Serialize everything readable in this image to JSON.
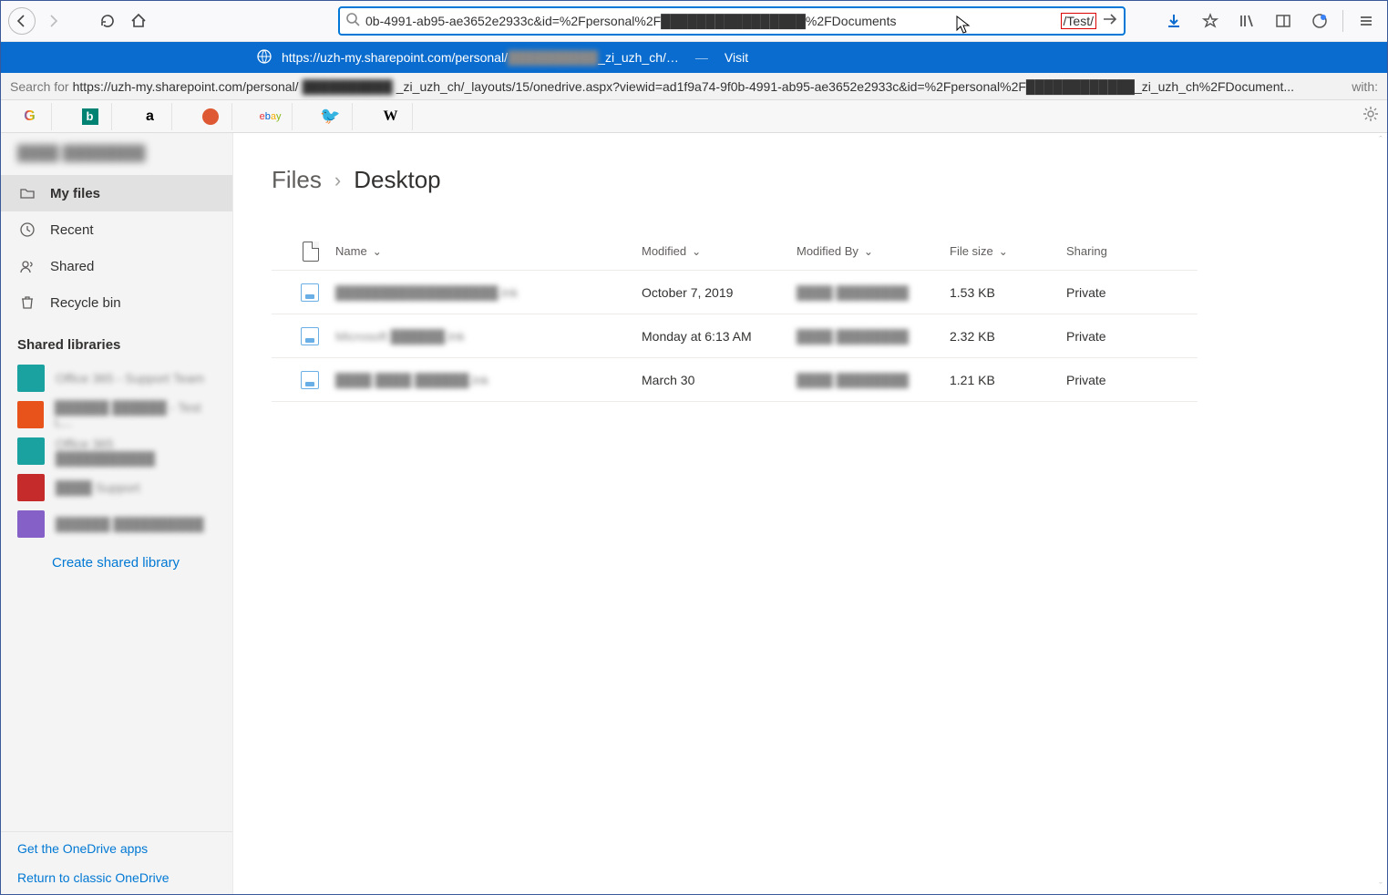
{
  "browser": {
    "url_text": "0b-4991-ab95-ae3652e2933c&id=%2Fpersonal%2F████████████████%2FDocuments",
    "url_highlight": "/Test/",
    "visit_url_pre": "https://uzh-my.sharepoint.com/personal/",
    "visit_url_mid": "██████████",
    "visit_url_post": "_zi_uzh_ch/",
    "visit_label": "Visit",
    "search_prefix": "Search for ",
    "search_url_pre": "https://uzh-my.sharepoint.com/personal/",
    "search_url_mid": "██████████",
    "search_url_post": "_zi_uzh_ch/_layouts/15/onedrive.aspx?viewid=ad1f9a74-9f0b-4991-ab95-ae3652e2933c&id=%2Fpersonal%2F████████████_zi_uzh_ch%2FDocument...",
    "search_with": " with:"
  },
  "bookmarks": [
    "G",
    "b",
    "a",
    "🦆",
    "ebay",
    "🐦",
    "W"
  ],
  "sidebar": {
    "user_name": "████ ████████",
    "nav": [
      {
        "label": "My files",
        "icon": "folder"
      },
      {
        "label": "Recent",
        "icon": "clock"
      },
      {
        "label": "Shared",
        "icon": "people"
      },
      {
        "label": "Recycle bin",
        "icon": "bin"
      }
    ],
    "libraries_title": "Shared libraries",
    "libraries": [
      {
        "color": "#19a2a0",
        "label": "Office 365 - Support Team"
      },
      {
        "color": "#e8531c",
        "label": "██████ ██████ - Test L..."
      },
      {
        "color": "#19a2a0",
        "label": "Office 365 ███████████"
      },
      {
        "color": "#c62b2b",
        "label": "████ Support"
      },
      {
        "color": "#8560c7",
        "label": "██████ ██████████"
      }
    ],
    "create_label": "Create shared library",
    "footer": {
      "apps": "Get the OneDrive apps",
      "classic": "Return to classic OneDrive"
    }
  },
  "breadcrumb": {
    "root": "Files",
    "current": "Desktop"
  },
  "columns": {
    "name": "Name",
    "modified": "Modified",
    "modifiedBy": "Modified By",
    "size": "File size",
    "sharing": "Sharing"
  },
  "rows": [
    {
      "name": "██████████████████.lnk",
      "modified": "October 7, 2019",
      "by": "████ ████████",
      "size": "1.53 KB",
      "sharing": "Private"
    },
    {
      "name": "Microsoft ██████.lnk",
      "modified": "Monday at 6:13 AM",
      "by": "████ ████████",
      "size": "2.32 KB",
      "sharing": "Private"
    },
    {
      "name": "████ ████ ██████.lnk",
      "modified": "March 30",
      "by": "████ ████████",
      "size": "1.21 KB",
      "sharing": "Private"
    }
  ]
}
